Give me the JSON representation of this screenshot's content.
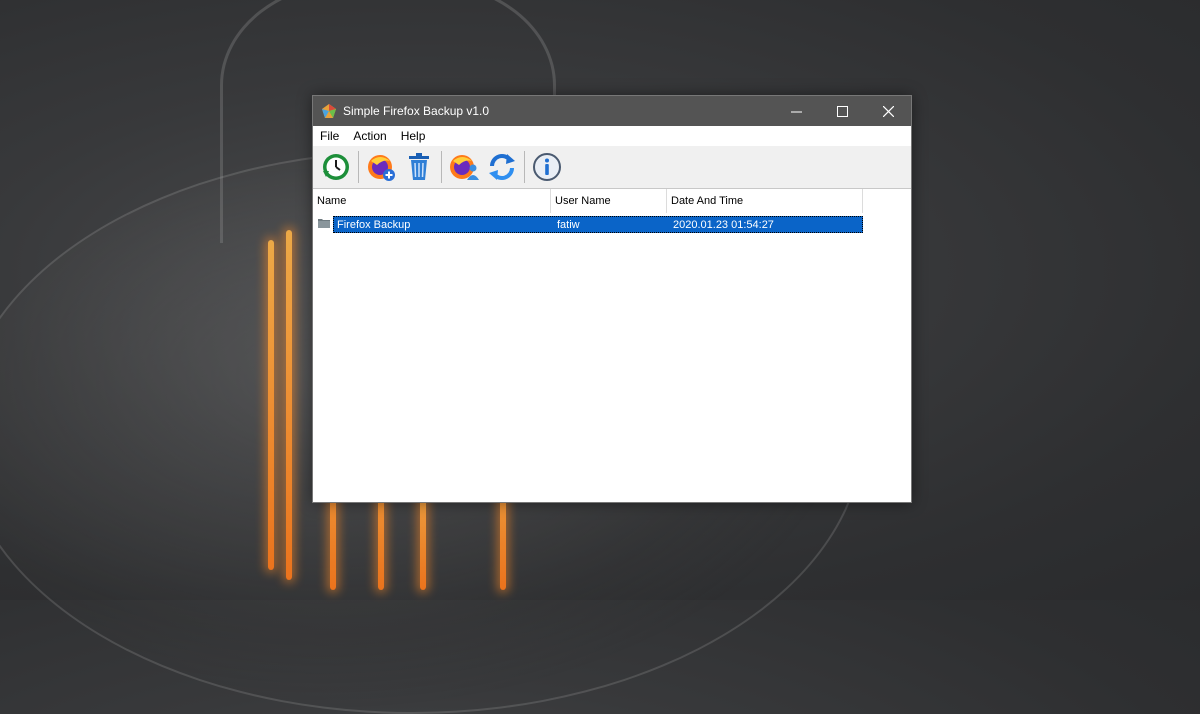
{
  "window": {
    "title": "Simple Firefox Backup v1.0",
    "controls": {
      "minimize": "—",
      "maximize": "☐",
      "close": "✕"
    }
  },
  "menu": {
    "items": [
      "File",
      "Action",
      "Help"
    ]
  },
  "toolbar": {
    "buttons": [
      {
        "icon": "backup-clock-icon"
      },
      {
        "icon": "firefox-add-icon"
      },
      {
        "icon": "trash-icon"
      },
      {
        "icon": "firefox-user-icon"
      },
      {
        "icon": "refresh-icon"
      },
      {
        "icon": "info-icon"
      }
    ]
  },
  "list": {
    "columns": [
      "Name",
      "User Name",
      "Date And Time"
    ],
    "rows": [
      {
        "name": "Firefox Backup",
        "user": "fatiw",
        "datetime": "2020.01.23 01:54:27",
        "selected": true
      }
    ]
  },
  "colors": {
    "titlebar": "#545454",
    "selection": "#0a64c8",
    "toolbar": "#f0f0f0"
  }
}
